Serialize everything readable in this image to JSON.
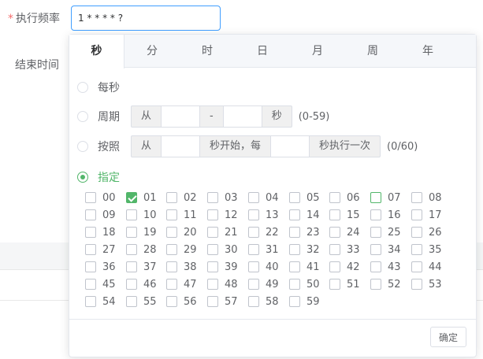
{
  "form": {
    "required_mark": "*",
    "frequency_label": "执行频率",
    "frequency_value": "1 * * * * ?",
    "end_time_label": "结束时间"
  },
  "tabs": [
    "秒",
    "分",
    "时",
    "日",
    "月",
    "周",
    "年"
  ],
  "active_tab": 0,
  "options": {
    "every": "每秒",
    "period": {
      "label": "周期",
      "from": "从",
      "dash": "-",
      "unit": "秒",
      "range": "(0-59)"
    },
    "interval": {
      "label": "按照",
      "from": "从",
      "mid": "秒开始，每",
      "end": "秒执行一次",
      "range": "(0/60)"
    },
    "specify": "指定"
  },
  "selected_option": "specify",
  "seconds": [
    "00",
    "01",
    "02",
    "03",
    "04",
    "05",
    "06",
    "07",
    "08",
    "09",
    "10",
    "11",
    "12",
    "13",
    "14",
    "15",
    "16",
    "17",
    "18",
    "19",
    "20",
    "21",
    "22",
    "23",
    "24",
    "25",
    "26",
    "27",
    "28",
    "29",
    "30",
    "31",
    "32",
    "33",
    "34",
    "35",
    "36",
    "37",
    "38",
    "39",
    "40",
    "41",
    "42",
    "43",
    "44",
    "45",
    "46",
    "47",
    "48",
    "49",
    "50",
    "51",
    "52",
    "53",
    "54",
    "55",
    "56",
    "57",
    "58",
    "59"
  ],
  "checked_seconds": [
    "01"
  ],
  "focused_seconds": [
    "07"
  ],
  "accent_color": "#52b66a",
  "footer": {
    "confirm": "确定"
  }
}
